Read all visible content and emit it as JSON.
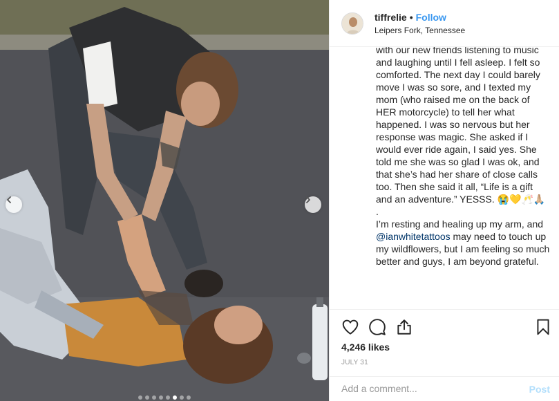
{
  "post": {
    "username": "tiffrelie",
    "separator": "•",
    "follow_label": "Follow",
    "location": "Leipers Fork, Tennessee",
    "caption_before_mention": "cleaned me up in the ambulance, sat with our new friends listening to music and laughing until I fell asleep. I felt so comforted. The next day I could barely move I was so sore, and I texted my mom (who raised me on the back of HER motorcycle) to tell her what happened. I was so nervous but her response was magic. She asked if I would ever ride again, I said yes. She told me she was so glad I was ok, and that she’s had her share of close calls too. Then she said it all, “Life is a gift and an adventure.” YESSS. 😭💛🥂🙏🏼\n.\nI’m resting and healing up my arm, and ",
    "mention": "@ianwhitetattoos",
    "caption_after_mention": " may need to touch up my wildflowers, but I am feeling so much better and guys, I am beyond grateful.",
    "likes": "4,246 likes",
    "date": "JULY 31"
  },
  "actions": {
    "like_icon": "heart-icon",
    "comment_icon": "comment-icon",
    "share_icon": "share-icon",
    "save_icon": "bookmark-icon"
  },
  "comment": {
    "placeholder": "Add a comment...",
    "post_label": "Post"
  },
  "carousel": {
    "total_slides": 8,
    "active_slide": 5
  },
  "colors": {
    "accent": "#3897f0",
    "mention": "#003569",
    "post_disabled": "#b2dffc"
  }
}
